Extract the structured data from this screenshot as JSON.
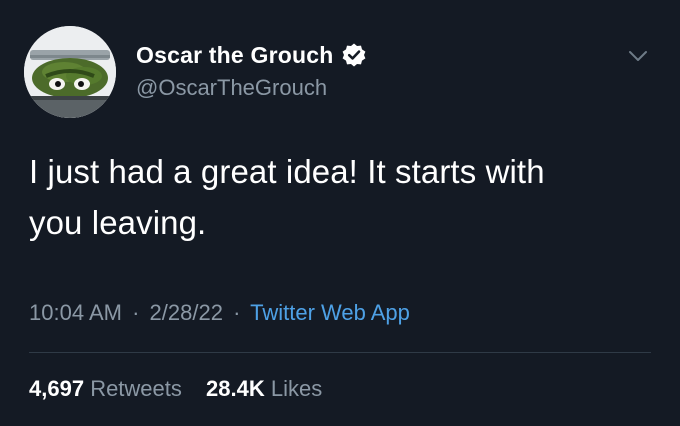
{
  "user": {
    "display_name": "Oscar the Grouch",
    "handle": "@OscarTheGrouch",
    "verified": true,
    "avatar_icon": "oscar-in-trash-can"
  },
  "tweet": {
    "text_line1": "I just had a great idea! It starts with",
    "text_line2": "you leaving.",
    "time": "10:04 AM",
    "date": "2/28/22",
    "source": "Twitter Web App",
    "separator": "·"
  },
  "stats": {
    "retweets_count": "4,697",
    "retweets_label": "Retweets",
    "likes_count": "28.4K",
    "likes_label": "Likes"
  },
  "colors": {
    "background": "#141a24",
    "text": "#ffffff",
    "secondary": "#8b98a5",
    "link": "#4ea1e6",
    "divider": "#2f3a46"
  }
}
